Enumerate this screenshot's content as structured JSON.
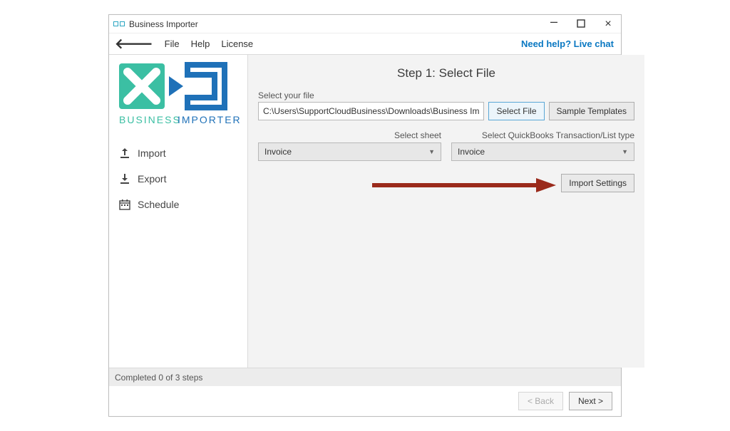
{
  "window": {
    "title": "Business Importer"
  },
  "menu": {
    "file": "File",
    "help": "Help",
    "license": "License",
    "help_link": "Need help? Live chat"
  },
  "logo": {
    "text_top": "BUSINESS",
    "text_bottom": "IMPORTER"
  },
  "sidebar": {
    "import": "Import",
    "export": "Export",
    "schedule": "Schedule"
  },
  "main": {
    "step_title": "Step 1: Select File",
    "select_file_label": "Select your file",
    "file_path": "C:\\Users\\SupportCloudBusiness\\Downloads\\Business Im",
    "select_file_btn": "Select File",
    "sample_templates_btn": "Sample Templates",
    "select_sheet_label": "Select sheet",
    "select_sheet_value": "Invoice",
    "qb_type_label": "Select QuickBooks Transaction/List type",
    "qb_type_value": "Invoice",
    "import_settings_btn": "Import Settings"
  },
  "status": {
    "text": "Completed 0 of 3 steps"
  },
  "wizard": {
    "back": "< Back",
    "next": "Next >"
  },
  "colors": {
    "accent_teal": "#3bbfa3",
    "accent_blue": "#1f71b8",
    "arrow": "#9a2a1b"
  }
}
